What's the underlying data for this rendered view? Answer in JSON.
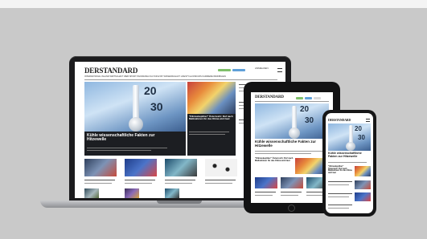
{
  "site": {
    "logo": "DERSTANDARD",
    "nav_items": [
      "INTERNATIONAL",
      "INLAND",
      "WIRTSCHAFT",
      "WEB",
      "SPORT",
      "PANORAMA",
      "KULTUR",
      "ETAT",
      "WISSENSCHAFT",
      "LIFESTYLE",
      "DISKURS",
      "KARRIERE",
      "IMMOBILIEN"
    ],
    "login_label": "ANMELDEN"
  },
  "hero": {
    "title": "Kühle wissenschaftliche Fakten zur Hitzewelle",
    "scale_marks": [
      "20",
      "30"
    ]
  },
  "side_story": {
    "title": "\"Klimaskeptiker\" Österreich: Ruf nach Maßnahmen für das Klima wird laut"
  },
  "colors": {
    "background": "#c9c9c9",
    "pill_accents": [
      "#7fbf6a",
      "#5fa0d8",
      "#d9d9d9"
    ]
  }
}
